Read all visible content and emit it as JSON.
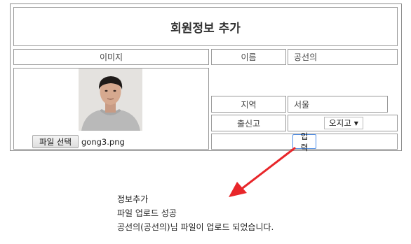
{
  "form": {
    "title": "회원정보 추가",
    "image_header": "이미지",
    "name_label": "이름",
    "name_value": "공선의",
    "region_label": "지역",
    "region_value": "서울",
    "school_label": "출신고",
    "school_selected": "오지고",
    "file_button": "파일 선택",
    "file_name": "gong3.png",
    "submit_label": "입력"
  },
  "messages": [
    "정보추가",
    "파일 업로드 성공",
    "공선의(공선의)님 파일이 업로드 되었습니다."
  ],
  "colors": {
    "arrow": "#e8262a",
    "submit_border": "#4f8ee6"
  }
}
